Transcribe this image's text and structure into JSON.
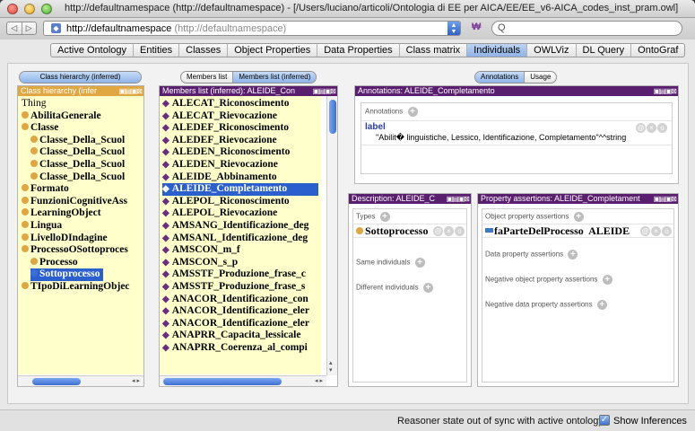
{
  "window": {
    "title": "http://defaultnamespace (http://defaultnamespace) - [/Users/luciano/articoli/Ontologia di EE per AICA/EE/EE_v6-AICA_codes_inst_pram.owl]"
  },
  "toolbar": {
    "back_label": "◁",
    "forward_label": "▷",
    "url": "http://defaultnamespace",
    "url_sub": "(http://defaultnamespace)",
    "find_label": "₩",
    "search_placeholder": "Q"
  },
  "tabs": [
    {
      "label": "Active Ontology"
    },
    {
      "label": "Entities"
    },
    {
      "label": "Classes"
    },
    {
      "label": "Object Properties"
    },
    {
      "label": "Data Properties"
    },
    {
      "label": "Class matrix"
    },
    {
      "label": "Individuals",
      "active": true
    },
    {
      "label": "OWLViz"
    },
    {
      "label": "DL Query"
    },
    {
      "label": "OntoGraf"
    }
  ],
  "class_panel": {
    "toggle_label": "Class hierarchy (inferred)",
    "header": "Class hierarchy (infer",
    "tree": [
      {
        "label": "Thing",
        "level": 0,
        "bullet": false,
        "bold": false
      },
      {
        "label": "AbilitaGenerale",
        "level": 0,
        "bullet": true
      },
      {
        "label": "Classe",
        "level": 0,
        "bullet": true
      },
      {
        "label": "Classe_Della_Scuol",
        "level": 1,
        "bullet": true
      },
      {
        "label": "Classe_Della_Scuol",
        "level": 1,
        "bullet": true
      },
      {
        "label": "Classe_Della_Scuol",
        "level": 1,
        "bullet": true
      },
      {
        "label": "Classe_Della_Scuol",
        "level": 1,
        "bullet": true
      },
      {
        "label": "Formato",
        "level": 0,
        "bullet": true
      },
      {
        "label": "FunzioniCognitiveAss",
        "level": 0,
        "bullet": true
      },
      {
        "label": "LearningObject",
        "level": 0,
        "bullet": true
      },
      {
        "label": "Lingua",
        "level": 0,
        "bullet": true
      },
      {
        "label": "LivelloDIndagine",
        "level": 0,
        "bullet": true
      },
      {
        "label": "ProcessoOSottoproces",
        "level": 0,
        "bullet": true
      },
      {
        "label": "Processo",
        "level": 1,
        "bullet": true
      },
      {
        "label": "Sottoprocesso",
        "level": 1,
        "bullet": true,
        "selected": true
      },
      {
        "label": "TIpoDiLearningObjec",
        "level": 0,
        "bullet": true
      }
    ]
  },
  "members_panel": {
    "toggle_left": "Members list",
    "toggle_right": "Members list (inferred)",
    "header": "Members list (inferred): ALEIDE_Con",
    "items": [
      "ALECAT_Riconoscimento",
      "ALECAT_Rievocazione",
      "ALEDEF_Riconoscimento",
      "ALEDEF_Rievocazione",
      "ALEDEN_Riconoscimento",
      "ALEDEN_Rievocazione",
      "ALEIDE_Abbinamento",
      "ALEIDE_Completamento",
      "ALEPOL_Riconoscimento",
      "ALEPOL_Rievocazione",
      "AMSANG_Identificazione_deg",
      "AMSANL_Identificazione_deg",
      "AMSCON_m_f",
      "AMSCON_s_p",
      "AMSSTF_Produzione_frase_c",
      "AMSSTF_Produzione_frase_s",
      "ANACOR_Identificazione_con",
      "ANACOR_Identificazione_eler",
      "ANACOR_Identificazione_eler",
      "ANAPRR_Capacita_lessicale",
      "ANAPRR_Coerenza_al_compi"
    ],
    "selected_index": 7
  },
  "annotations_panel": {
    "toggle_left": "Annotations",
    "toggle_right": "Usage",
    "header": "Annotations: ALEIDE_Completamento",
    "section_label": "Annotations",
    "label_key": "label",
    "label_value": "\"Abilit� linguistiche, Lessico, Identificazione, Completamento\"^^string"
  },
  "description_panel": {
    "header": "Description: ALEIDE_C",
    "types_label": "Types",
    "type_value": "Sottoprocesso",
    "same_individuals": "Same individuals",
    "different_individuals": "Different individuals"
  },
  "property_panel": {
    "header": "Property assertions: ALEIDE_Completament",
    "object_label": "Object property assertions",
    "object_value": "faParteDelProcesso  ALEIDE",
    "data_label": "Data property assertions",
    "neg_object_label": "Negative object property assertions",
    "neg_data_label": "Negative data property assertions"
  },
  "status": {
    "message": "Reasoner state out of sync with active ontology",
    "show_inferences_label": "Show Inferences",
    "show_inferences_checked": true
  },
  "colors": {
    "tree_bg": "#ffffcc",
    "header_purple": "#5a1e6e",
    "header_orange": "#e0a640",
    "selection": "#2b5fce"
  }
}
